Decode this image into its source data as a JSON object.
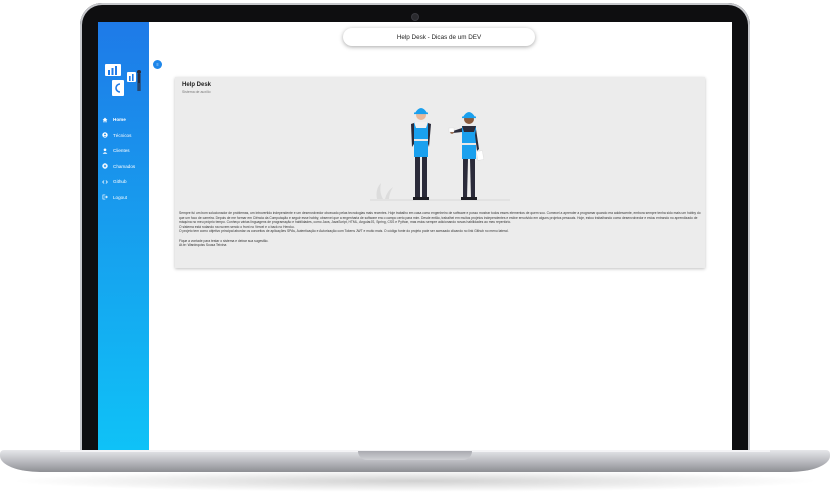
{
  "window": {
    "title": "Help Desk - Dicas de um DEV"
  },
  "sidebar": {
    "toggle_label": "≡",
    "items": [
      {
        "label": "Home",
        "icon": "home-icon",
        "active": true
      },
      {
        "label": "Técnicos",
        "icon": "person-circle-icon"
      },
      {
        "label": "Clientes",
        "icon": "person-icon"
      },
      {
        "label": "Chamados",
        "icon": "ticket-icon"
      },
      {
        "label": "Github",
        "icon": "code-icon"
      },
      {
        "label": "Logout",
        "icon": "logout-icon"
      }
    ]
  },
  "card": {
    "title": "Help Desk",
    "subtitle": "Sistema de auxílio",
    "paragraphs": [
      "Sempre fui um bom solucionador de problemas, um introvertido independente e um desenvolvedor obcecado pelas tecnologias mais recentes. Hoje trabalho em casa como engenheiro de software e posso mostrar todos esses elementos de quem sou. Comecei a aprender a programar quando era adolescente, embora sempre tenha sido mais um hobby do que um foco de carreira. Depois de me formar em Ciência da Computação e seguir esse hobby, observei que a engenharia de software era o campo certo para mim. Desde então, trabalhei em muitos projetos independentes e estive envolvido em alguns projetos pessoais. Hoje, estou trabalhando como desenvolvedor e estou entrando no aprendizado de máquina no meu próprio tempo. Conheço várias linguagens de programação e habilidades, como Java, JavaScript, HTML, AngularJS, Spring, CSS e Python, mas estou sempre adicionando novas habilidades ao meu repertório.",
      "O sistema está rodando na nuvem sendo o front no Vercel e o back no Heroku.",
      "O projeto tem como objetivo principal abordar os conceitos de aplicações SPAs, Autenticação e Autorização com Tokens JWT e muito mais. O código fonte do projeto pode ser acessado clicando no link Github no menu lateral.",
      "",
      "Fique a vontade para testar o sistema e deixar sua sugestão.",
      "At.te: Wardnquiss Sousa Teixina"
    ]
  },
  "colors": {
    "sidebar_top": "#1e7ae8",
    "sidebar_bottom": "#0fc2f7",
    "card_bg": "#ececec",
    "helmet": "#1aa0ee"
  }
}
